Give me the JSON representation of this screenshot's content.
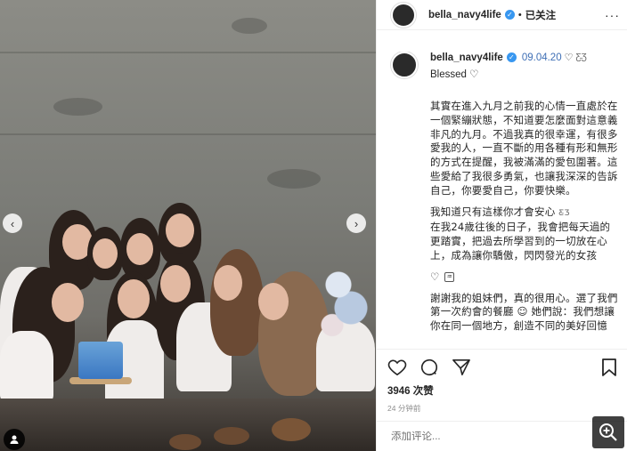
{
  "header": {
    "username": "bella_navy4life",
    "separator": "•",
    "follow_status": "已关注",
    "more_icon": "more-horizontal-icon"
  },
  "caption": {
    "username": "bella_navy4life",
    "date": "09.04.20",
    "first_line": "Blessed",
    "paragraphs": [
      "其實在進入九月之前我的心情一直處於在一個緊繃狀態，不知道要怎麼面對這意義非凡的九月。不過我真的很幸運，有很多愛我的人，一直不斷的用各種有形和無形的方式在提醒，我被滿滿的愛包圍著。這些愛給了我很多勇氣，也讓我深深的告訴自己，你要愛自己，你要快樂。",
      "我知道只有這樣你才會安心",
      "在我24歲往後的日子，我會把每天過的更踏實，把過去所學習到的一切放在心上，成為讓你驕傲，閃閃發光的女孩",
      "謝謝我的姐妹們，真的很用心。選了我們第一次約會的餐廳",
      "她們說：我們想讓你在同一個地方，創造不同的美好回憶"
    ]
  },
  "post": {
    "likes": "3946 次赞",
    "time": "24 分钟前",
    "comment_placeholder": "添加评论..."
  },
  "colors": {
    "verified": "#3897f0",
    "date_link": "#3f6fb5",
    "muted": "#8e8e8e"
  }
}
